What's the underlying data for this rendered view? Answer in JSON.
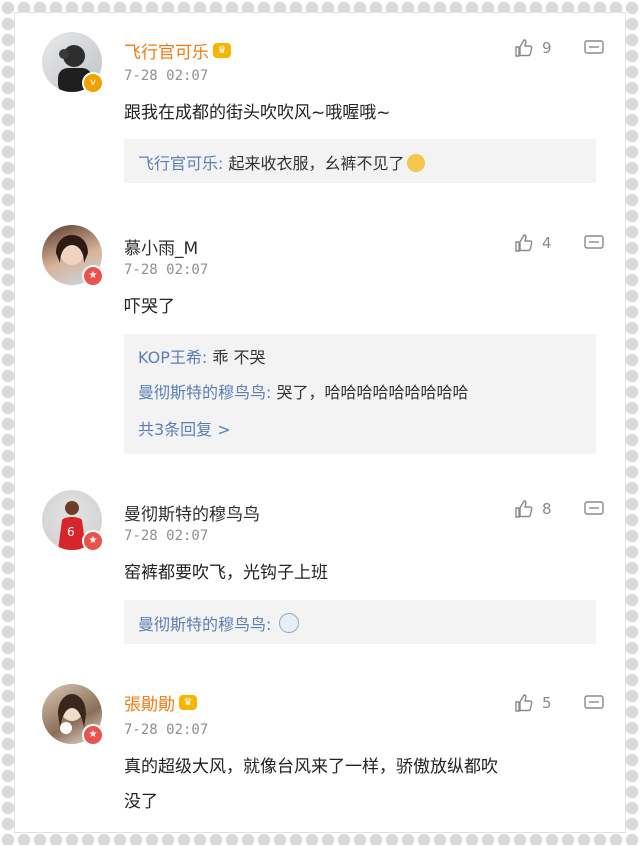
{
  "comments": [
    {
      "user": "飞行官可乐",
      "time": "7-28 02:07",
      "likes": "9",
      "text": "跟我在成都的街头吹吹风~哦喔哦~",
      "replies": [
        {
          "user": "飞行官可乐:",
          "text": " 起来收衣服，幺裤不见了"
        }
      ]
    },
    {
      "user": "慕小雨_M",
      "time": "7-28 02:07",
      "likes": "4",
      "text": "吓哭了",
      "replies": [
        {
          "user": "KOP王希:",
          "text": " 乖 不哭"
        },
        {
          "user": "曼彻斯特的穆鸟鸟:",
          "text": " 哭了，哈哈哈哈哈哈哈哈哈"
        }
      ],
      "more": "共3条回复 >"
    },
    {
      "user": "曼彻斯特的穆鸟鸟",
      "time": "7-28 02:07",
      "likes": "8",
      "text": "窑裤都要吹飞，光钩子上班",
      "replies": [
        {
          "user": "曼彻斯特的穆鸟鸟:",
          "text": " "
        }
      ]
    },
    {
      "user": "張勛勛",
      "time": "7-28 02:07",
      "likes": "5",
      "text_line1": "真的超级大风，就像台风来了一样，骄傲放纵都吹",
      "text_line2": "没了"
    }
  ],
  "colors": {
    "reply_user": "#5b7fb5",
    "vip_name": "#f07a12",
    "meta": "#8f8f8f"
  }
}
